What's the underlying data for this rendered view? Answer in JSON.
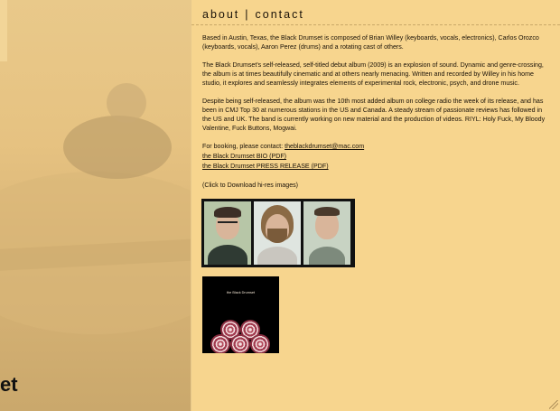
{
  "nav": {
    "about": "about",
    "separator": "|",
    "contact": "contact"
  },
  "left_panel": {
    "brand_fragment": "et"
  },
  "body": {
    "p1": "Based in Austin, Texas, the Black Drumset is composed of Brian Willey (keyboards, vocals, electronics), Carlos Orozco (keyboards, vocals),  Aaron Perez (drums) and a rotating cast of others.",
    "p2": "The Black Drumset's self-released, self-titled debut album (2009) is an explosion of sound. Dynamic and genre-crossing, the album is at times beautifully cinematic and at others nearly menacing. Written and recorded by Willey in his home studio, it explores and seamlessly integrates elements of experimental rock, electronic, psych, and drone music.",
    "p3": "Despite being self-released, the album was the 10th most added album on college radio the week of its release, and has been in CMJ Top 30 at numerous stations in the US and Canada.  A steady stream of passionate reviews has followed in the US and UK. The band is currently working on new material and the production of videos. RIYL: Holy Fuck, My Bloody Valentine, Fuck Buttons, Mogwai.",
    "booking_prefix": "For booking, please contact: ",
    "booking_email": "theblackdrumset@mac.com",
    "bio_link": "the Black Drumset BIO (PDF)",
    "press_link": "the Black Drumset PRESS RELEASE (PDF)",
    "download_note": "(Click to Download hi-res images)"
  },
  "album": {
    "title": "the Black Drumset"
  }
}
